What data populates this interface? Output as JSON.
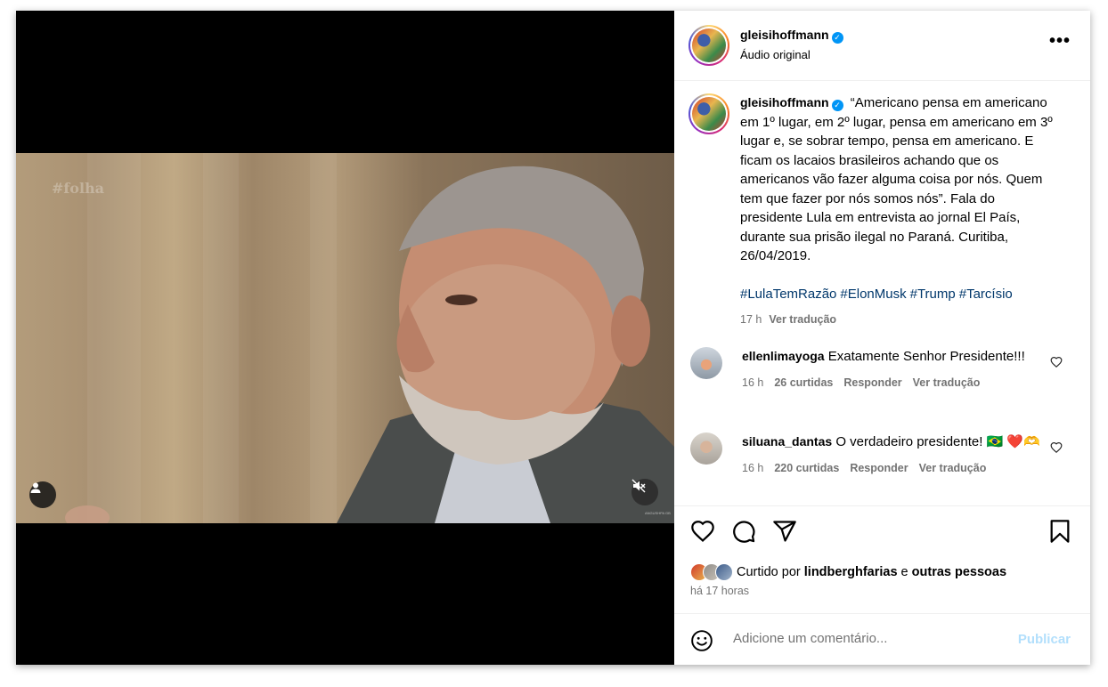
{
  "post": {
    "author": "gleisihoffmann",
    "audio_label": "Áudio original",
    "more_label": "•••",
    "media": {
      "watermark": "#folha",
      "bottom_mark": "ANGUSHPA GB"
    },
    "caption": {
      "username": "gleisihoffmann",
      "text": "“Americano pensa em americano em 1º lugar, em 2º lugar, pensa em americano em 3º lugar e, se sobrar tempo, pensa em americano. E ficam os lacaios brasileiros achando que os americanos vão fazer alguma coisa por nós. Quem tem que fazer por nós somos nós”. Fala do presidente Lula em entrevista ao jornal El País, durante sua prisão ilegal no Paraná. Curitiba, 26/04/2019.",
      "hashtags": [
        "#LulaTemRazão",
        "#ElonMusk",
        "#Trump",
        "#Tarcísio"
      ],
      "time": "17 h",
      "translate": "Ver tradução"
    },
    "comments": [
      {
        "username": "ellenlimayoga",
        "text": "Exatamente Senhor Presidente!!!",
        "time": "16 h",
        "likes": "26 curtidas",
        "reply": "Responder",
        "translate": "Ver tradução"
      },
      {
        "username": "siluana_dantas",
        "text": "O verdadeiro presidente! 🇧🇷 ❤️🫶",
        "time": "16 h",
        "likes": "220 curtidas",
        "reply": "Responder",
        "translate": "Ver tradução"
      }
    ],
    "likes_summary": {
      "prefix": "Curtido por",
      "user": "lindberghfarias",
      "joiner": "e",
      "others": "outras pessoas"
    },
    "posted_ago": "há 17 horas"
  },
  "comment_box": {
    "placeholder": "Adicione um comentário...",
    "submit": "Publicar"
  },
  "colors": {
    "verified": "#0095f6",
    "hashtag": "#00376b",
    "muted": "#737373",
    "publish_disabled": "#b2dffc"
  },
  "icons": [
    "person-icon",
    "mute-icon",
    "verified-icon",
    "more-icon",
    "heart-icon",
    "comment-icon",
    "share-icon",
    "bookmark-icon",
    "emoji-icon"
  ]
}
